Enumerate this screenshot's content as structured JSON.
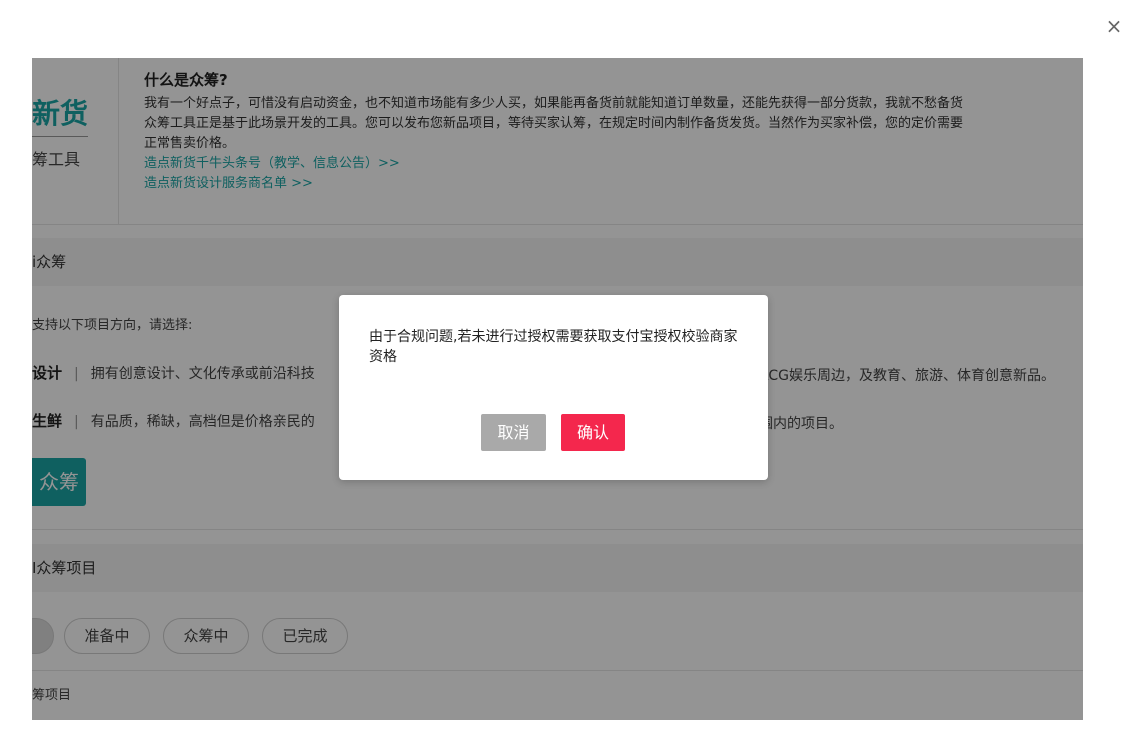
{
  "window": {
    "close_glyph": "×"
  },
  "intro": {
    "brand_title": "新货",
    "brand_subtitle": "筹工具",
    "heading": "什么是众筹?",
    "paragraph_line1": "我有一个好点子，可惜没有启动资金，也不知道市场能有多少人买，如果能再备货前就能知道订单数量，还能先获得一部分货款，我就不愁备货",
    "paragraph_line2": "众筹工具正是基于此场景开发的工具。您可以发布您新品项目，等待买家认筹，在规定时间内制作备货发货。当然作为买家补偿，您的定价需要",
    "paragraph_line3": "正常售卖价格。",
    "link1": "造点新货千牛头条号（教学、信息公告）>>",
    "link2": "造点新货设计服务商名单 >>"
  },
  "publish": {
    "section_title": "i众筹",
    "hint": "支持以下项目方向，请选择:",
    "directions": [
      {
        "name": "设计",
        "desc_left": "拥有创意设计、文化传承或前沿科技",
        "desc_right": "ACG娱乐周边，及教育、旅游、体育创意新品。"
      },
      {
        "name": "生鲜",
        "desc_left": "有品质，稀缺，高档但是价格亲民的",
        "desc_right": "围内的项目。"
      }
    ],
    "separator": "|",
    "cta_label": "众筹"
  },
  "projects": {
    "section_title": "I众筹项目",
    "filters": [
      "准备中",
      "众筹中",
      "已完成"
    ],
    "list_header": "筹项目"
  },
  "dialog": {
    "message": "由于合规问题,若未进行过授权需要获取支付宝授权校验商家资格",
    "cancel_label": "取消",
    "confirm_label": "确认"
  },
  "colors": {
    "accent": "#1aa5a5",
    "confirm": "#f4274d",
    "cancel": "#a9a9a9"
  }
}
